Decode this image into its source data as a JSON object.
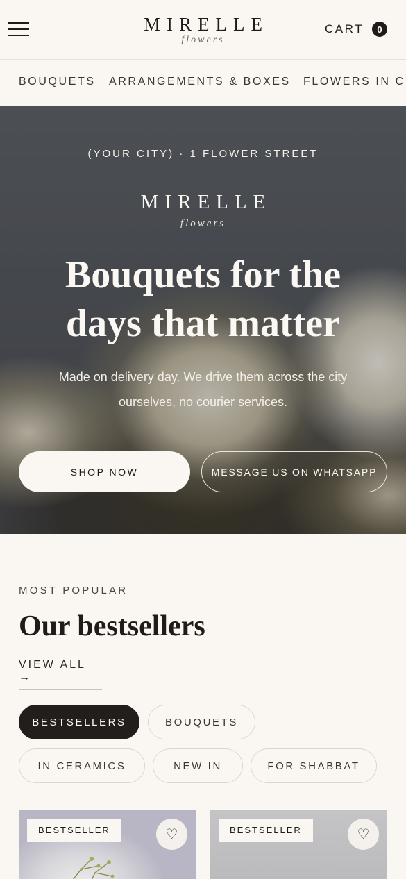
{
  "header": {
    "logo_main": "MIRELLE",
    "logo_sub": "flowers",
    "cart_label": "CART",
    "cart_count": "0"
  },
  "catnav": {
    "items": [
      "BOUQUETS",
      "ARRANGEMENTS & BOXES",
      "FLOWERS IN CERAMICS"
    ]
  },
  "hero": {
    "address": "(YOUR CITY) · 1 FLOWER STREET",
    "logo_main": "MIRELLE",
    "logo_sub": "flowers",
    "title_line1": "Bouquets for the",
    "title_line2": "days that matter",
    "subtitle": "Made on delivery day. We drive them across the city ourselves, no courier services.",
    "shop_button": "SHOP NOW",
    "whatsapp_button": "MESSAGE US ON WHATSAPP"
  },
  "bestsellers": {
    "eyebrow": "MOST POPULAR",
    "title": "Our bestsellers",
    "view_all": "VIEW ALL →",
    "filters": [
      "BESTSELLERS",
      "BOUQUETS",
      "IN CERAMICS",
      "NEW IN",
      "FOR SHABBAT"
    ],
    "active_filter": "BESTSELLERS",
    "cards": [
      {
        "badge": "BESTSELLER",
        "icon": "heart-icon"
      },
      {
        "badge": "BESTSELLER",
        "icon": "heart-icon"
      }
    ]
  },
  "colors": {
    "background": "#faf7f2",
    "text": "#1f1b18",
    "active_pill": "#221e1b"
  }
}
